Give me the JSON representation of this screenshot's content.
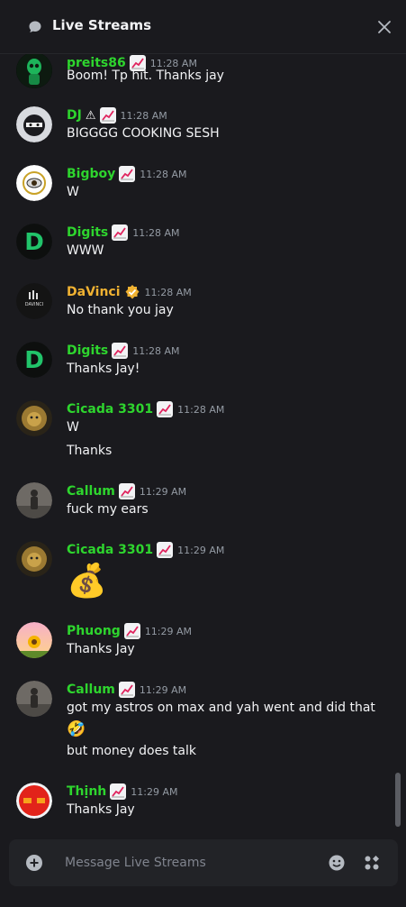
{
  "header": {
    "title": "Live Streams"
  },
  "composer": {
    "placeholder": "Message Live Streams"
  },
  "colors": {
    "username_green": "#2ed52e",
    "username_gold": "#f0b232",
    "background": "#1a1a1e"
  },
  "messages": [
    {
      "user": "preits86",
      "badge": "chart-increasing",
      "time": "11:28 AM",
      "lines": [
        "Boom! Tp hit. Thanks jay"
      ],
      "avatar": "green-skull-avatar"
    },
    {
      "user": "DJ",
      "extra": "⚠",
      "badge": "chart-increasing",
      "time": "11:28 AM",
      "lines": [
        "BIGGGG COOKING SESH"
      ],
      "avatar": "ninja-avatar"
    },
    {
      "user": "Bigboy",
      "badge": "chart-increasing",
      "time": "11:28 AM",
      "lines": [
        "W"
      ],
      "avatar": "eye-avatar"
    },
    {
      "user": "Digits",
      "badge": "chart-increasing",
      "time": "11:28 AM",
      "lines": [
        "WWW"
      ],
      "avatar": "digits-d-avatar"
    },
    {
      "user": "DaVinci",
      "badge": "verified",
      "time": "11:28 AM",
      "lines": [
        "No thank you jay"
      ],
      "avatar": "davinci-avatar",
      "avatar_text": "DAVINCI"
    },
    {
      "user": "Digits",
      "badge": "chart-increasing",
      "time": "11:28 AM",
      "lines": [
        "Thanks Jay!"
      ],
      "avatar": "digits-d-avatar"
    },
    {
      "user": "Cicada 3301",
      "badge": "chart-increasing",
      "time": "11:28 AM",
      "lines": [
        "W",
        "Thanks"
      ],
      "avatar": "lion-avatar"
    },
    {
      "user": "Callum",
      "badge": "chart-increasing",
      "time": "11:29 AM",
      "lines": [
        "fuck my ears"
      ],
      "avatar": "person-photo-avatar"
    },
    {
      "user": "Cicada 3301",
      "badge": "chart-increasing",
      "time": "11:29 AM",
      "lines": [
        "💰"
      ],
      "avatar": "lion-avatar"
    },
    {
      "user": "Phuong",
      "badge": "chart-increasing",
      "time": "11:29 AM",
      "lines": [
        "Thanks Jay"
      ],
      "avatar": "sunflower-avatar"
    },
    {
      "user": "Callum",
      "badge": "chart-increasing",
      "time": "11:29 AM",
      "lines": [
        "got my astros on max and yah went and did that",
        "🤣",
        "but money does talk"
      ],
      "avatar": "person-photo-avatar"
    },
    {
      "user": "Thịnh",
      "badge": "chart-increasing",
      "time": "11:29 AM",
      "lines": [
        "Thanks Jay"
      ],
      "avatar": "red-cross-avatar"
    }
  ]
}
